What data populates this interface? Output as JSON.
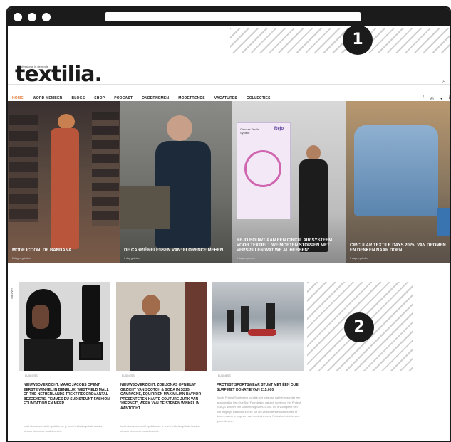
{
  "badges": {
    "one": "1",
    "two": "2"
  },
  "logo": {
    "text": "textilia.",
    "tagline": "Professional in de mode"
  },
  "search_icon": "⌕",
  "nav": [
    "HOME",
    "WORD MEMBER",
    "BLOGS",
    "SHOP",
    "PODCAST",
    "ONDERNEMEN",
    "MODETRENDS",
    "VACATURES",
    "COLLECTIES"
  ],
  "social": [
    "f",
    "◎",
    "▾",
    "in"
  ],
  "hero": [
    {
      "caption": "MODE ICOON: DE BANDANA",
      "date": "2 dagen geleden"
    },
    {
      "caption": "DE CARRIÈRELESSEN VAN: FLORENCE MEHEN",
      "date": "1 dag geleden"
    },
    {
      "caption": "REJO BOUWT AAN EEN CIRCULAIR SYSTEEM VOOR TEXTIEL: 'WE MOETEN STOPPEN MET VERSPILLEN WAT WE AL HEBBEN'",
      "date": "3 dagen geleden"
    },
    {
      "caption": "CIRCULAR TEXTILE DAYS 2025: VAN DROMEN EN DENKEN NAAR DOEN",
      "date": "3 dagen geleden"
    }
  ],
  "poster": {
    "title": "Circulair Textile System",
    "brand": "Rejo"
  },
  "side_label": "NIEUWS",
  "cards": [
    {
      "tag": "BUSINESS",
      "title": "NIEUWSOVERZICHT: MARC JACOBS OPENT EERSTE WINKEL IN BENELUX, WESTFIELD MALL OF THE NETHERLANDS TREKT RECORDAANTAL BEZOEKERS, FEMMES DU SUD STEUNT FASHION FOUNDATION EN MEER",
      "excerpt": "In dit nieuwsoverzicht updaten we je over het belangrijkste fashion nieuws binnen de modebranche"
    },
    {
      "tag": "BUSINESS",
      "title": "NIEUWSOVERZICHT: ZOE JONAS OPNIEUW GEZICHT VAN SCOTCH & SODA IN SS25-CAMPAGNE, EQUIRR EN MAXIMILIAN RAYNOR PRESENTEREN HAUTE COUTURE-JURK VAN 'HIERNET', WEEK VAN DE STENEN WINKEL IN AANTOCHT",
      "excerpt": "In dit nieuwsoverzicht updaten we je over het belangrijkste fashion nieuws binnen de modebranche"
    },
    {
      "tag": "BUSINESS",
      "title": "PROTEST SPORTSWEAR STUNT MET ÉÉN QUE SURF MET DONATIE VAN €15.000",
      "excerpt": "Sports Protest Sportswear kondigt met trots aan dat het bijzonder een gezamenlijke ffen Que Surf Foundation, dat zich inzet voor het Protest TEAQS doneert een vast bedrag van €15.000. Dit is voortgezet van wat mogelijk. Daarvoor zijn ze. Dit om verschillende locaties mee te doen en weer in te geven aan de deelnemers. Protest zet zich in voor gezonde zee..."
    }
  ]
}
